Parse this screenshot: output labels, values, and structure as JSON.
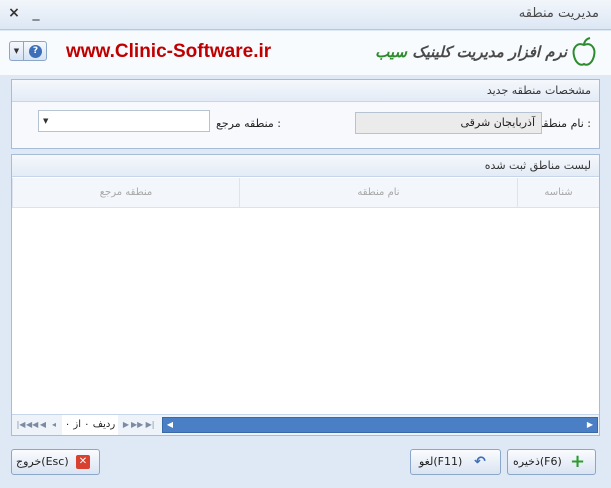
{
  "window": {
    "title": "مدیریت منطقه",
    "close_glyph": "×",
    "minimize_glyph": "_"
  },
  "header": {
    "url": "www.Clinic-Software.ir",
    "brand_text": "نرم افزار مدیریت کلینیک",
    "brand_accent": "سیب",
    "help_glyph": "?",
    "dropdown_glyph": "▼"
  },
  "new_region": {
    "title": "مشخصات منطقه جدید",
    "name_label": "نام منطقه :",
    "name_value": "آذربایجان شرقی",
    "parent_label": "منطقه مرجع :",
    "parent_value": ""
  },
  "list": {
    "title": "لیست مناطق ثبت شده",
    "columns": [
      "شناسه",
      "نام منطقه",
      "منطقه مرجع"
    ],
    "rows": [],
    "nav_text": "ردیف ۰ از ۰"
  },
  "buttons": {
    "exit": "خروج(Esc)",
    "cancel": "لغو(F11)",
    "save": "ذخیره(F6)"
  },
  "colors": {
    "url": "#c00000",
    "brand_accent": "#2e8b2e",
    "scroll_thumb": "#4a7fc6"
  }
}
